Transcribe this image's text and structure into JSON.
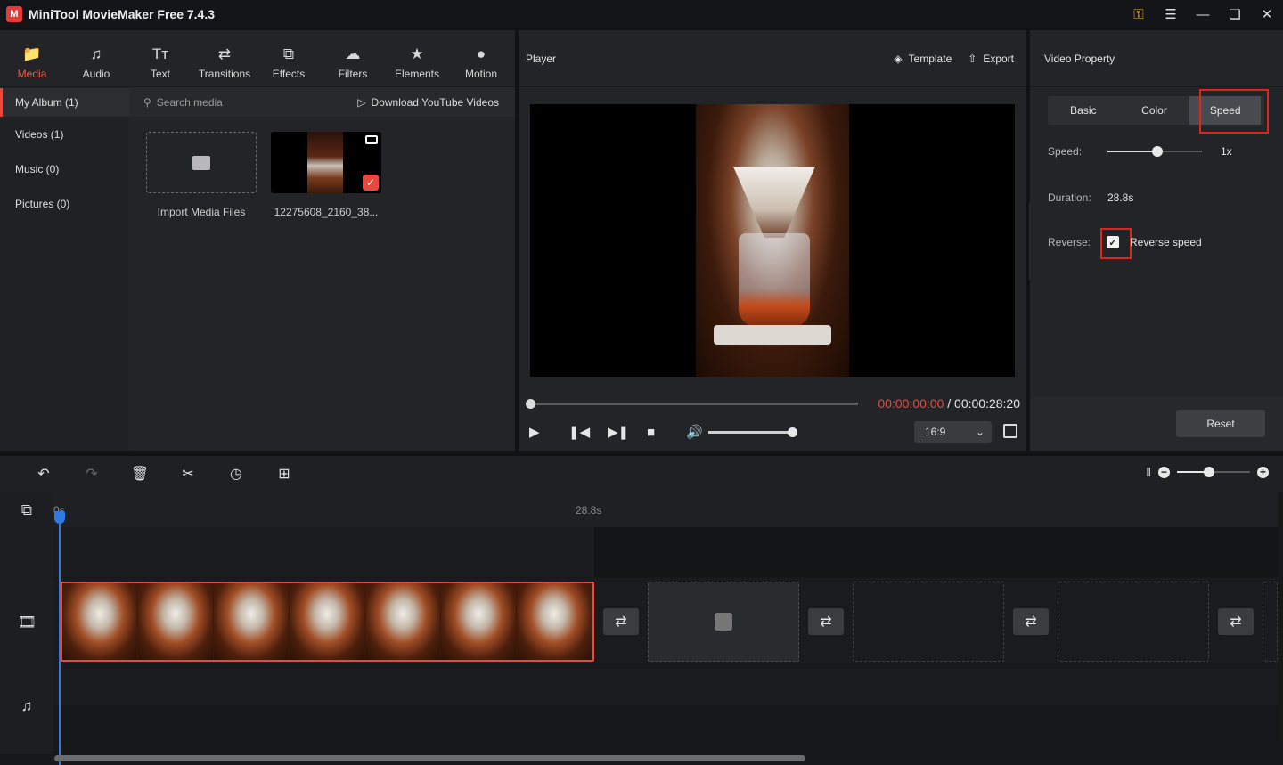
{
  "app": {
    "title": "MiniTool MovieMaker Free 7.4.3",
    "logo": "M"
  },
  "toolbar": {
    "tabs": [
      {
        "label": "Media",
        "icon": "folder-icon",
        "active": true
      },
      {
        "label": "Audio",
        "icon": "music-icon",
        "active": false
      },
      {
        "label": "Text",
        "icon": "text-icon",
        "active": false
      },
      {
        "label": "Transitions",
        "icon": "transition-icon",
        "active": false
      },
      {
        "label": "Effects",
        "icon": "effects-icon",
        "active": false
      },
      {
        "label": "Filters",
        "icon": "filters-icon",
        "active": false
      },
      {
        "label": "Elements",
        "icon": "elements-icon",
        "active": false
      },
      {
        "label": "Motion",
        "icon": "motion-icon",
        "active": false
      }
    ]
  },
  "albums": [
    {
      "label": "My Album (1)",
      "active": true
    },
    {
      "label": "Videos (1)",
      "active": false
    },
    {
      "label": "Music (0)",
      "active": false
    },
    {
      "label": "Pictures (0)",
      "active": false
    }
  ],
  "media": {
    "search_placeholder": "Search media",
    "download_label": "Download YouTube Videos",
    "import_label": "Import Media Files",
    "file_label": "12275608_2160_38..."
  },
  "player": {
    "title": "Player",
    "template_label": "Template",
    "export_label": "Export",
    "current_time": "00:00:00:00",
    "separator": " / ",
    "total_time": "00:00:28:20",
    "aspect_ratio": "16:9",
    "progress": 0,
    "volume": 1.0
  },
  "properties": {
    "title": "Video Property",
    "tabs": [
      "Basic",
      "Color",
      "Speed"
    ],
    "active_tab": "Speed",
    "speed_label": "Speed:",
    "speed_value": "1x",
    "speed_level": 0.5,
    "duration_label": "Duration:",
    "duration_value": "28.8s",
    "reverse_label": "Reverse:",
    "reverse_text": "Reverse speed",
    "reverse_checked": true,
    "reset_label": "Reset",
    "highlight_color": "#e0261b"
  },
  "timeline": {
    "ruler_start": "0s",
    "ruler_end": "28.8s",
    "zoom_level": 0.45
  },
  "colors": {
    "accent": "#e8493d",
    "playhead": "#2f7be5"
  }
}
